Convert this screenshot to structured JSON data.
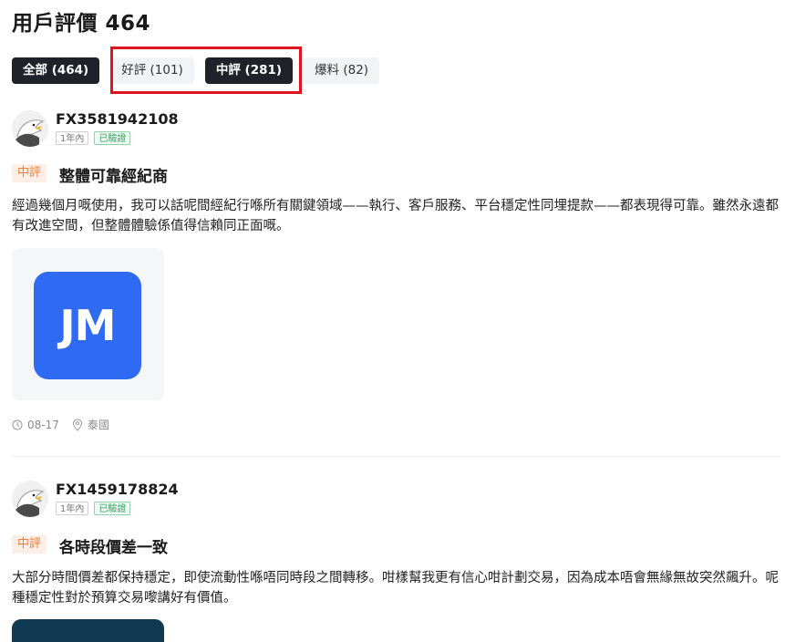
{
  "page": {
    "title": "用戶評價 464"
  },
  "tabs": [
    {
      "label": "全部 (464)",
      "active": true
    },
    {
      "label": "好評 (101)",
      "active": false
    },
    {
      "label": "中評 (281)",
      "active": true
    },
    {
      "label": "爆料 (82)",
      "active": false
    }
  ],
  "colors": {
    "highlight": "#e0141f",
    "accent_tag": "#f07a3a",
    "verified": "#2fa55a",
    "jm_logo": "#2f6bf2"
  },
  "reviews": [
    {
      "user": "FX3581942108",
      "duration_badge": "1年內",
      "verified_badge": "已驗證",
      "rating_tag": "中評",
      "title": "整體可靠經紀商",
      "text": "經過幾個月嘅使用，我可以話呢間經紀行喺所有關鍵領域——執行、客戶服務、平台穩定性同埋提款——都表現得可靠。雖然永遠都有改進空間，但整體體驗係值得信賴同正面嘅。",
      "image_text": "JM",
      "date": "08-17",
      "location": "泰國"
    },
    {
      "user": "FX1459178824",
      "duration_badge": "1年內",
      "verified_badge": "已驗證",
      "rating_tag": "中評",
      "title": "各時段價差一致",
      "text": "大部分時間價差都保持穩定，即使流動性喺唔同時段之間轉移。咁樣幫我更有信心咁計劃交易，因為成本唔會無緣無故突然飆升。呢種穩定性對於預算交易嚟講好有價值。"
    }
  ]
}
